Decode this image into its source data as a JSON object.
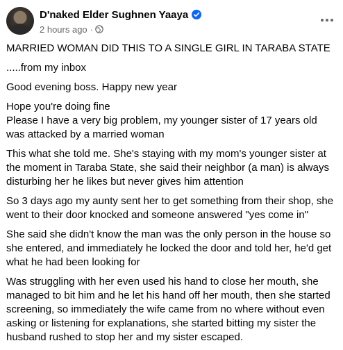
{
  "post": {
    "author": "D'naked Elder Sughnen Yaaya",
    "timestamp": "2 hours ago",
    "separator": "·",
    "verified_icon": "verified-badge-icon",
    "privacy_icon": "globe-icon",
    "accent_color": "#0866ff",
    "paragraphs": [
      "MARRIED WOMAN DID THIS TO A SINGLE GIRL IN TARABA STATE",
      ".....from my inbox",
      "Good evening boss. Happy new year",
      "Hope you're doing fine",
      "Please I have a very big problem, my younger sister of 17 years old was attacked by a married woman",
      "This what she told me. She's staying with my mom's younger sister at the moment in Taraba State, she said their neighbor (a man) is always disturbing her he likes but never gives him attention",
      "So 3 days ago my aunty sent her to get something from their shop, she went to their door knocked and someone answered \"yes come in\"",
      "She said she didn't know the man was the only person in the house so she entered, and immediately he locked the door and told her, he'd get what he had been looking for",
      "Was struggling with her even used his hand to close her mouth, she managed to bit him and he let his hand off her mouth, then she started screening, so immediately the wife came from no where without even asking or listening for explanations, she started bitting my sister the husband rushed to stop her and my sister escaped."
    ]
  }
}
